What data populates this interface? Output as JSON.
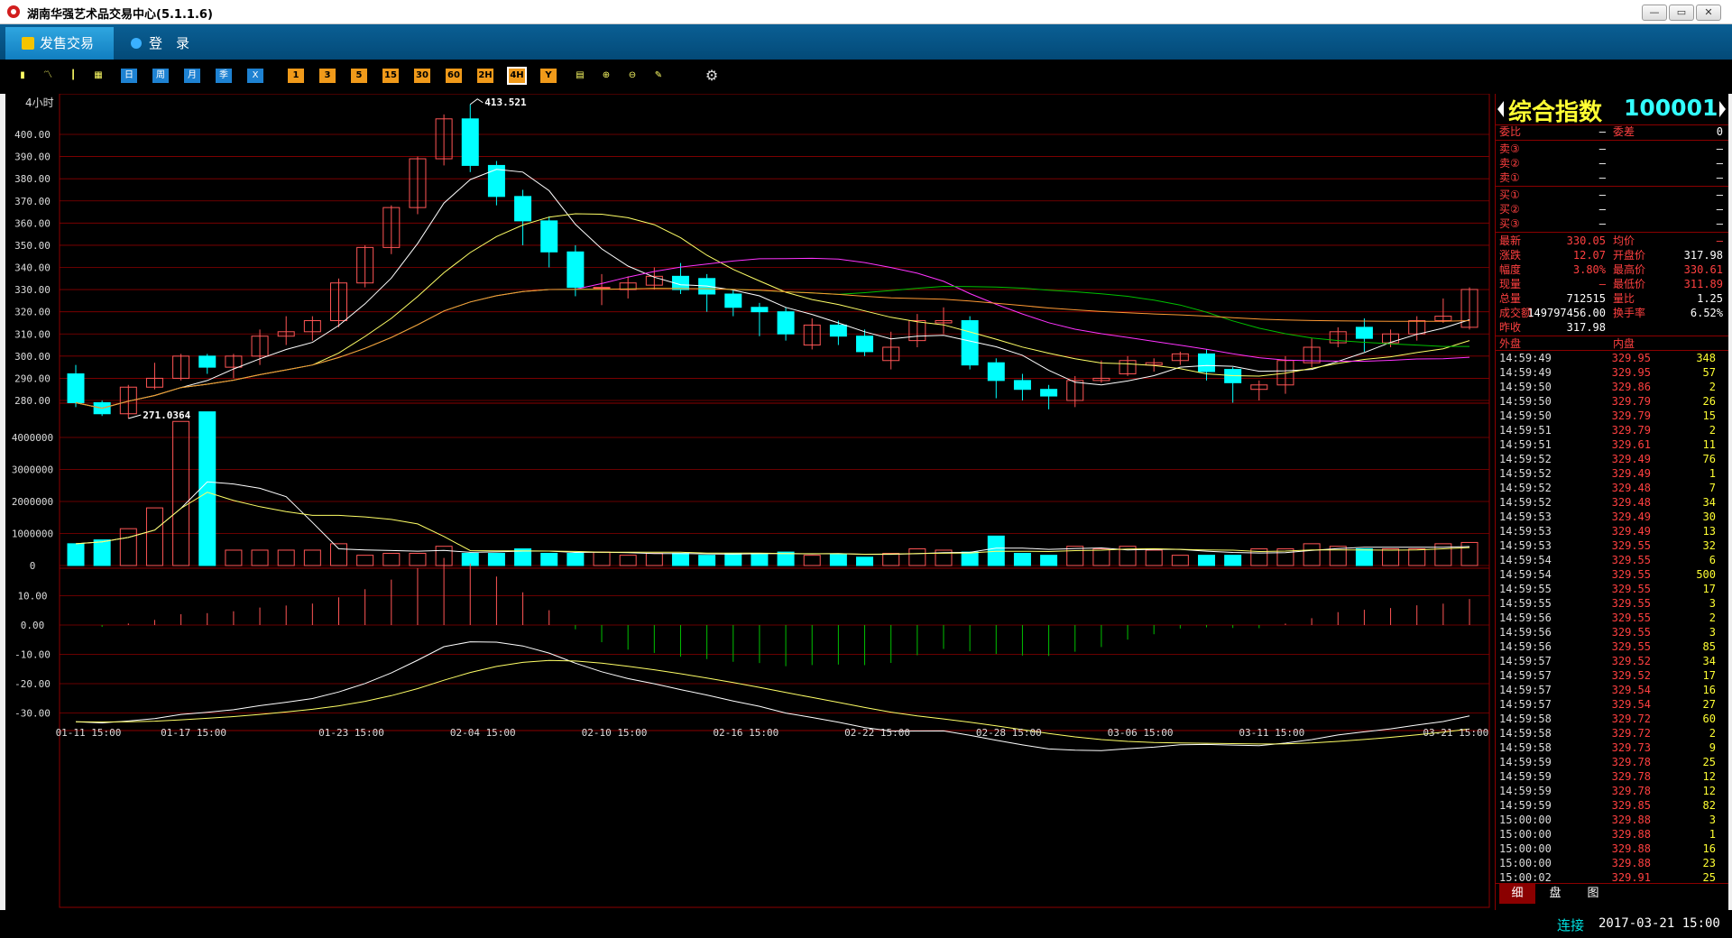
{
  "window": {
    "title": "湖南华强艺术品交易中心(5.1.1.6)",
    "min_label": "—",
    "max_label": "▭",
    "close_label": "✕"
  },
  "menu": {
    "sell_trade": "发售交易",
    "login": "登　录"
  },
  "toolbar": {
    "left_icons": [
      "bar-chart-icon",
      "line-chart-icon",
      "candles-icon",
      "calendar-icon"
    ],
    "periods_blue": [
      "日",
      "周",
      "月",
      "季",
      "X"
    ],
    "periods_orange": [
      "1",
      "3",
      "5",
      "15",
      "30",
      "60",
      "2H",
      "4H",
      "Y"
    ],
    "right_icons": [
      "draw-icon",
      "zoom-in-icon",
      "zoom-out-icon",
      "pen-icon",
      "settings-icon"
    ],
    "active_period": "4H"
  },
  "chart": {
    "period_label": "4小时",
    "high_label": "413.521",
    "low_label": "271.0364",
    "price_ticks": [
      "400.00",
      "390.00",
      "380.00",
      "370.00",
      "360.00",
      "350.00",
      "340.00",
      "330.00",
      "320.00",
      "310.00",
      "300.00",
      "290.00",
      "280.00"
    ],
    "vol_ticks": [
      "4000000",
      "3000000",
      "2000000",
      "1000000",
      "0"
    ],
    "macd_ticks": [
      "10.00",
      "0.00",
      "-10.00",
      "-20.00",
      "-30.00"
    ],
    "date_ticks": [
      "01-11 15:00",
      "01-17 15:00",
      "01-23 15:00",
      "02-04 15:00",
      "02-10 15:00",
      "02-16 15:00",
      "02-22 15:00",
      "02-28 15:00",
      "03-06 15:00",
      "03-11 15:00",
      "03-21 15:00"
    ],
    "colors": {
      "up": "#ff5555",
      "down": "#00ffff",
      "grid": "#8b0000",
      "ma5": "#ffffff",
      "ma10": "#ffff66",
      "ma20": "#ff33ff",
      "ma30": "#00c000",
      "ma60": "#ff9933"
    }
  },
  "chart_data": {
    "type": "candlestick",
    "candles": [
      [
        292,
        279,
        296,
        277
      ],
      [
        279,
        274,
        280,
        273
      ],
      [
        274,
        286,
        287,
        272
      ],
      [
        286,
        290,
        297,
        285
      ],
      [
        290,
        300,
        301,
        289
      ],
      [
        300,
        295,
        301,
        292
      ],
      [
        295,
        300,
        301,
        290
      ],
      [
        300,
        309,
        312,
        296
      ],
      [
        309,
        311,
        318,
        305
      ],
      [
        311,
        316,
        318,
        307
      ],
      [
        316,
        333,
        335,
        313
      ],
      [
        333,
        349,
        350,
        331
      ],
      [
        349,
        367,
        368,
        346
      ],
      [
        367,
        389,
        390,
        364
      ],
      [
        389,
        407,
        409,
        386
      ],
      [
        407,
        386,
        413.521,
        383
      ],
      [
        386,
        372,
        388,
        368
      ],
      [
        372,
        361,
        375,
        350
      ],
      [
        361,
        347,
        363,
        340
      ],
      [
        347,
        331,
        350,
        327
      ],
      [
        331,
        331,
        337,
        323
      ],
      [
        330,
        333,
        336,
        326
      ],
      [
        332,
        336,
        340,
        330
      ],
      [
        336,
        330,
        342,
        328
      ],
      [
        335,
        328,
        337,
        320
      ],
      [
        328,
        322,
        330,
        318
      ],
      [
        322,
        320,
        324,
        309
      ],
      [
        320,
        310,
        322,
        307
      ],
      [
        305,
        314,
        317,
        303
      ],
      [
        314,
        309,
        316,
        305
      ],
      [
        309,
        302,
        312,
        300
      ],
      [
        298,
        304,
        311,
        294
      ],
      [
        307,
        316,
        319,
        304
      ],
      [
        315,
        316,
        322,
        310
      ],
      [
        316,
        296,
        318,
        294
      ],
      [
        297,
        289,
        299,
        281
      ],
      [
        289,
        285,
        292,
        280
      ],
      [
        285,
        282,
        287,
        276
      ],
      [
        280,
        289,
        291,
        277
      ],
      [
        289,
        290,
        298,
        288
      ],
      [
        292,
        298,
        300,
        291
      ],
      [
        296,
        297,
        299,
        293
      ],
      [
        298,
        301,
        302,
        296
      ],
      [
        301,
        293,
        303,
        289
      ],
      [
        294,
        288,
        295,
        279
      ],
      [
        285,
        287,
        289,
        280
      ],
      [
        287,
        298,
        300,
        283
      ],
      [
        297,
        304,
        308,
        295
      ],
      [
        306,
        311,
        313,
        304
      ],
      [
        313,
        308,
        317,
        302
      ],
      [
        306,
        310,
        312,
        304
      ],
      [
        310,
        316,
        318,
        307
      ],
      [
        316,
        318,
        326,
        315
      ],
      [
        313,
        330.05,
        331,
        312
      ]
    ],
    "volume": [
      680000,
      800000,
      1150000,
      1800000,
      4500000,
      4800000,
      480000,
      480000,
      480000,
      480000,
      680000,
      320000,
      380000,
      380000,
      600000,
      380000,
      380000,
      520000,
      380000,
      380000,
      420000,
      320000,
      380000,
      380000,
      320000,
      380000,
      380000,
      420000,
      320000,
      360000,
      260000,
      380000,
      520000,
      480000,
      420000,
      920000,
      380000,
      320000,
      600000,
      520000,
      600000,
      480000,
      320000,
      320000,
      320000,
      520000,
      520000,
      680000,
      600000,
      520000,
      520000,
      520000,
      680000,
      720000
    ],
    "macd_ticks_range": [
      -35,
      15
    ],
    "ylim_price": [
      271,
      414
    ],
    "ylim_volume": [
      0,
      5000000
    ]
  },
  "panel": {
    "name": "综合指数",
    "code": "100001",
    "weibi": {
      "label": "委比",
      "value": "—",
      "label2": "委差",
      "value2": "0"
    },
    "asks": [
      {
        "label": "卖③",
        "price": "—",
        "vol": "—"
      },
      {
        "label": "卖②",
        "price": "—",
        "vol": "—"
      },
      {
        "label": "卖①",
        "price": "—",
        "vol": "—"
      }
    ],
    "bids": [
      {
        "label": "买①",
        "price": "—",
        "vol": "—"
      },
      {
        "label": "买②",
        "price": "—",
        "vol": "—"
      },
      {
        "label": "买③",
        "price": "—",
        "vol": "—"
      }
    ],
    "quote": [
      {
        "l1": "最新",
        "v1": "330.05",
        "l2": "均价",
        "v2": "—"
      },
      {
        "l1": "涨跌",
        "v1": "12.07",
        "l2": "开盘价",
        "v2": "317.98"
      },
      {
        "l1": "幅度",
        "v1": "3.80%",
        "l2": "最高价",
        "v2": "330.61"
      },
      {
        "l1": "现量",
        "v1": "—",
        "l2": "最低价",
        "v2": "311.89"
      },
      {
        "l1": "总量",
        "v1": "712515",
        "l2": "量比",
        "v2": "1.25"
      },
      {
        "l1": "成交额",
        "v1": "149797456.00",
        "l2": "换手率",
        "v2": "6.52%"
      },
      {
        "l1": "昨收",
        "v1": "317.98",
        "l2": "",
        "v2": ""
      }
    ],
    "outer": "外盘",
    "inner": "内盘",
    "ticks": [
      [
        "14:59:49",
        "329.95",
        "348"
      ],
      [
        "14:59:49",
        "329.95",
        "57"
      ],
      [
        "14:59:50",
        "329.86",
        "2"
      ],
      [
        "14:59:50",
        "329.79",
        "26"
      ],
      [
        "14:59:50",
        "329.79",
        "15"
      ],
      [
        "14:59:51",
        "329.79",
        "2"
      ],
      [
        "14:59:51",
        "329.61",
        "11"
      ],
      [
        "14:59:52",
        "329.49",
        "76"
      ],
      [
        "14:59:52",
        "329.49",
        "1"
      ],
      [
        "14:59:52",
        "329.48",
        "7"
      ],
      [
        "14:59:52",
        "329.48",
        "34"
      ],
      [
        "14:59:53",
        "329.49",
        "30"
      ],
      [
        "14:59:53",
        "329.49",
        "13"
      ],
      [
        "14:59:53",
        "329.55",
        "32"
      ],
      [
        "14:59:54",
        "329.55",
        "6"
      ],
      [
        "14:59:54",
        "329.55",
        "500"
      ],
      [
        "14:59:55",
        "329.55",
        "17"
      ],
      [
        "14:59:55",
        "329.55",
        "3"
      ],
      [
        "14:59:56",
        "329.55",
        "2"
      ],
      [
        "14:59:56",
        "329.55",
        "3"
      ],
      [
        "14:59:56",
        "329.55",
        "85"
      ],
      [
        "14:59:57",
        "329.52",
        "34"
      ],
      [
        "14:59:57",
        "329.52",
        "17"
      ],
      [
        "14:59:57",
        "329.54",
        "16"
      ],
      [
        "14:59:57",
        "329.54",
        "27"
      ],
      [
        "14:59:58",
        "329.72",
        "60"
      ],
      [
        "14:59:58",
        "329.72",
        "2"
      ],
      [
        "14:59:58",
        "329.73",
        "9"
      ],
      [
        "14:59:59",
        "329.78",
        "25"
      ],
      [
        "14:59:59",
        "329.78",
        "12"
      ],
      [
        "14:59:59",
        "329.78",
        "12"
      ],
      [
        "14:59:59",
        "329.85",
        "82"
      ],
      [
        "15:00:00",
        "329.88",
        "3"
      ],
      [
        "15:00:00",
        "329.88",
        "1"
      ],
      [
        "15:00:00",
        "329.88",
        "16"
      ],
      [
        "15:00:00",
        "329.88",
        "23"
      ],
      [
        "15:00:02",
        "329.91",
        "25"
      ]
    ],
    "tabs": [
      "细",
      "盘",
      "图"
    ]
  },
  "status": {
    "connection": "连接",
    "datetime": "2017-03-21 15:00"
  }
}
